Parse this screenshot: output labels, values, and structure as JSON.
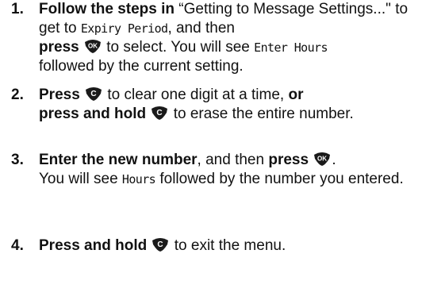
{
  "steps": [
    {
      "number": "1.",
      "lead_bold": "Follow the steps in",
      "quote": "“Getting to Message Settings...\"",
      "to_get_to": "to get to",
      "lcd_expiry": "Expiry Period",
      "and_then": ", and then",
      "press_bold": "press",
      "to_select": "to select. You will see",
      "lcd_enter_hours": "Enter Hours",
      "tail": "followed by the current setting."
    },
    {
      "number": "2.",
      "press_bold": "Press",
      "clear_text": "to clear one digit at a time,",
      "or_bold": "or",
      "press_hold_bold": "press and hold",
      "erase_text": "to erase the entire number."
    },
    {
      "number": "3.",
      "enter_bold": "Enter the new number",
      "and_then": ", and then",
      "press_bold": "press",
      "period": ".",
      "you_will_see": "You will see",
      "lcd_hours": "Hours",
      "tail": "followed by the number you entered."
    },
    {
      "number": "4.",
      "press_hold_bold": "Press and hold",
      "tail": "to exit the menu."
    }
  ],
  "keys": {
    "ok": {
      "label": "OK",
      "icon": "ok-key-icon",
      "color": "#1a1a1a"
    },
    "clear": {
      "label": "C",
      "icon": "clear-key-icon",
      "color": "#1a1a1a"
    }
  }
}
